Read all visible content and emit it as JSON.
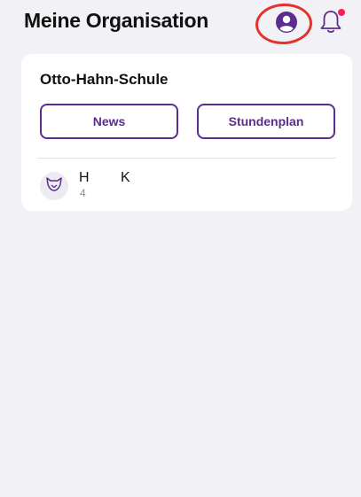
{
  "header": {
    "title": "Meine Organisation",
    "profile_icon": "user-circle-icon",
    "bell_icon": "bell-icon",
    "has_notification": true
  },
  "school": {
    "name": "Otto-Hahn-Schule",
    "buttons": {
      "news": "News",
      "timetable": "Stundenplan"
    }
  },
  "members": [
    {
      "avatar_icon": "fox-icon",
      "first": "H",
      "last": "K",
      "sub": "4"
    }
  ],
  "colors": {
    "accent": "#5b2d8e",
    "highlight": "#e5322b",
    "notification": "#ff1f4b",
    "background": "#f2f2f6"
  }
}
